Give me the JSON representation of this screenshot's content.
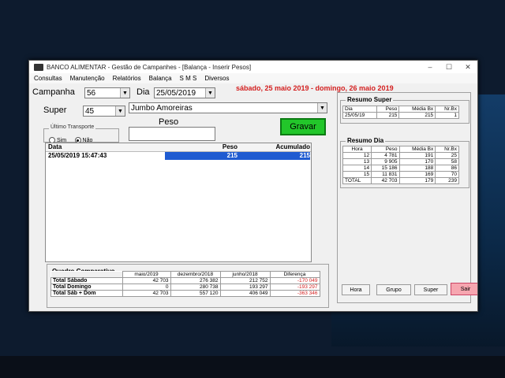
{
  "window": {
    "title": "BANCO ALIMENTAR - Gestão de Campanhes - [Balança - Inserir Pesos]",
    "controls": [
      "–",
      "☐",
      "✕"
    ]
  },
  "menu": [
    "Consultas",
    "Manutenção",
    "Relatórios",
    "Balança",
    "S M S",
    "Diversos"
  ],
  "header": {
    "campanha_label": "Campanha",
    "campanha_value": "56",
    "dia_label": "Dia",
    "dia_value": "25/05/2019",
    "date_line": "sábado, 25 maio 2019 - domingo, 26 maio 2019"
  },
  "super": {
    "label": "Super",
    "code": "45",
    "name": "Jumbo Amoreiras"
  },
  "transporte": {
    "title": "Último Transporte",
    "options": [
      {
        "label": "Sim",
        "selected": false
      },
      {
        "label": "Não",
        "selected": true
      }
    ]
  },
  "peso": {
    "label": "Peso",
    "value": ""
  },
  "gravar_label": "Gravar",
  "entries": {
    "columns": [
      "Data",
      "Peso",
      "Acumulado"
    ],
    "rows": [
      {
        "data": "25/05/2019 15:47:43",
        "peso": "215",
        "acumulado": "215"
      }
    ]
  },
  "quadro": {
    "title": "Quadro Comparativo",
    "columns": [
      "maio/2019",
      "dezembro/2018",
      "junho/2018",
      "Diferença"
    ],
    "rows": [
      {
        "label": "Total Sábado",
        "values": [
          "42 703",
          "276 382",
          "212 752",
          "-170 049"
        ]
      },
      {
        "label": "Total Domingo",
        "values": [
          "0",
          "280 738",
          "193 297",
          "-193 297"
        ]
      },
      {
        "label": "Total Sáb + Dom",
        "values": [
          "42 703",
          "557 120",
          "406 049",
          "-363 346"
        ]
      }
    ]
  },
  "resumo_super": {
    "title": "Resumo Super",
    "columns": [
      "Dia",
      "Peso",
      "Média Bx",
      "Nr.Bx"
    ],
    "rows": [
      [
        "25/05/19",
        "215",
        "215",
        "1"
      ]
    ]
  },
  "resumo_dia": {
    "title": "Resumo Dia",
    "columns": [
      "Hora",
      "Peso",
      "Média Bx",
      "Nr.Bx"
    ],
    "rows": [
      [
        "12",
        "4 781",
        "191",
        "25"
      ],
      [
        "13",
        "9 905",
        "170",
        "58"
      ],
      [
        "14",
        "15 186",
        "188",
        "86"
      ],
      [
        "15",
        "11 831",
        "169",
        "70"
      ],
      [
        "TOTAL",
        "42 703",
        "179",
        "239"
      ]
    ]
  },
  "bottom_buttons": [
    "Hora",
    "Grupo",
    "Super",
    "Sair"
  ],
  "colors": {
    "green_button": "#22c62a",
    "selection": "#1f5bd1",
    "date_red": "#d42020",
    "sair": "#f6a6b0"
  }
}
